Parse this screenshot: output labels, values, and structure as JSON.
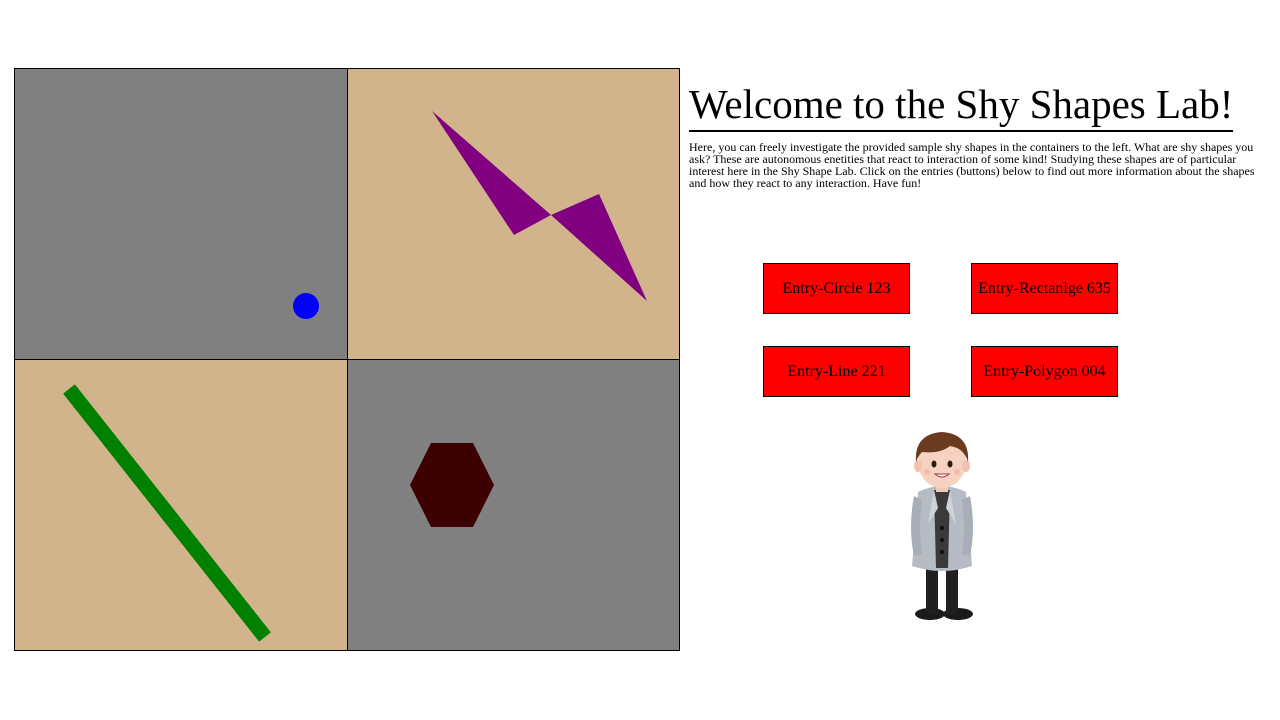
{
  "page": {
    "title": "Welcome to the Shy Shapes Lab!",
    "intro": "Here, you can freely investigate the provided sample shy shapes in the containers to the left. What are shy shapes you ask? These are autonomous enetities that react to interaction of some kind! Studying these shapes are of particular interest here in the Shy Shape Lab. Click on the entries (buttons) below to find out more information about the shapes and how they react to any interaction. Have fun!"
  },
  "containers": {
    "top_left": {
      "background": "#808080",
      "shape": "circle",
      "shape_color": "#0000ff"
    },
    "top_right": {
      "background": "#d2b48c",
      "shape": "polygon",
      "shape_color": "#800080"
    },
    "bottom_left": {
      "background": "#d2b48c",
      "shape": "line",
      "shape_color": "#008000"
    },
    "bottom_right": {
      "background": "#808080",
      "shape": "hexagon",
      "shape_color": "#3d0000"
    }
  },
  "entries": {
    "circle": "Entry-Circle 123",
    "rectangle": "Entry-Rectanlge 635",
    "line": "Entry-Line 221",
    "polygon": "Entry-Polygon 004"
  },
  "colors": {
    "button_bg": "#ff0000",
    "border": "#000000"
  },
  "icons": {
    "mascot": "scientist-character"
  }
}
